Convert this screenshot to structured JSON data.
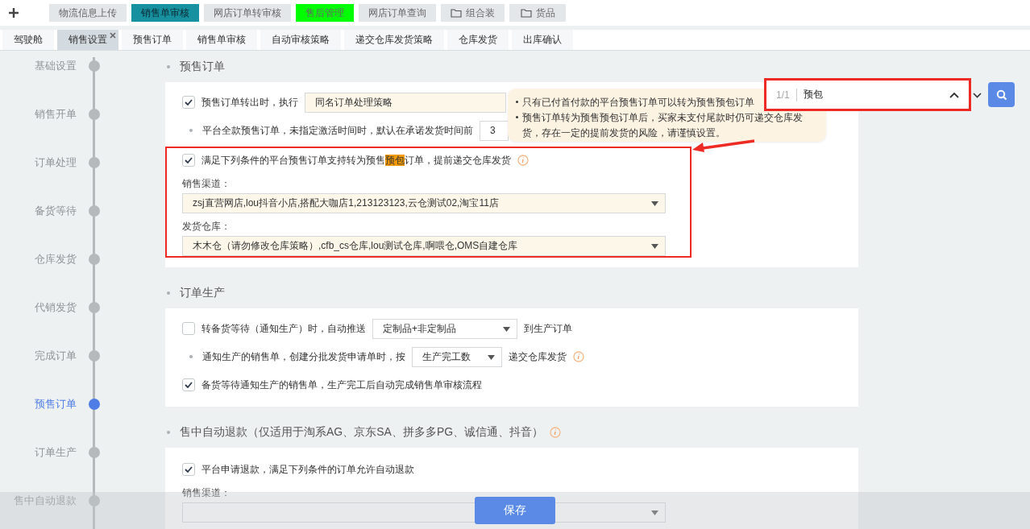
{
  "top_tabs": [
    {
      "label": "物流信息上传",
      "selected": false,
      "color": "#e4e7ea"
    },
    {
      "label": "销售单审核",
      "selected": true,
      "color": "#17909f"
    },
    {
      "label": "网店订单转审核",
      "selected": false,
      "color": "#e4e7ea"
    },
    {
      "label": "售后管理",
      "selected": false,
      "color": "#00ff00"
    },
    {
      "label": "网店订单查询",
      "selected": false,
      "color": "#e4e7ea"
    },
    {
      "label": "组合装",
      "selected": false,
      "folder": true,
      "color": "#e4e7ea"
    },
    {
      "label": "货品",
      "selected": false,
      "folder": true,
      "color": "#e4e7ea"
    }
  ],
  "sub_tabs": [
    {
      "label": "驾驶舱",
      "selected": false,
      "closable": false
    },
    {
      "label": "销售设置",
      "selected": true,
      "closable": true
    },
    {
      "label": "预售订单",
      "selected": false,
      "closable": false
    },
    {
      "label": "销售单审核",
      "selected": false,
      "closable": false
    },
    {
      "label": "自动审核策略",
      "selected": false,
      "closable": false
    },
    {
      "label": "递交仓库发货策略",
      "selected": false,
      "closable": false
    },
    {
      "label": "仓库发货",
      "selected": false,
      "closable": false
    },
    {
      "label": "出库确认",
      "selected": false,
      "closable": false
    }
  ],
  "timeline": [
    {
      "label": "基础设置",
      "selected": false
    },
    {
      "label": "销售开单",
      "selected": false
    },
    {
      "label": "订单处理",
      "selected": false
    },
    {
      "label": "备货等待",
      "selected": false
    },
    {
      "label": "仓库发货",
      "selected": false
    },
    {
      "label": "代销发货",
      "selected": false
    },
    {
      "label": "完成订单",
      "selected": false
    },
    {
      "label": "预售订单",
      "selected": true
    },
    {
      "label": "订单生产",
      "selected": false
    },
    {
      "label": "售中自动退款",
      "selected": false
    }
  ],
  "sections": [
    {
      "heading": "预售订单",
      "rows": [
        {
          "kind": "check_select",
          "checked": true,
          "label": "预售订单转出时，执行",
          "value": "同名订单处理策略"
        },
        {
          "kind": "bullet_input",
          "label": "平台全款预售订单，未指定激活时间时，默认在承诺发货时间前",
          "value": "3"
        },
        {
          "kind": "check_group",
          "checked": true,
          "outlined": true,
          "label_before": "满足下列条件的平台预售订单支持转为预售",
          "match": "预包",
          "label_after": "订单，提前递交仓库发货",
          "info": true,
          "fields": [
            {
              "label": "销售渠道：",
              "value": "zsj直营网店,lou抖音小店,搭配大咖店1,213123123,云仓测试02,淘宝11店"
            },
            {
              "label": "发货仓库：",
              "value": "木木仓（请勿修改仓库策略）,cfb_cs仓库,lou测试仓库,啊喂仓,OMS自建仓库"
            }
          ]
        }
      ]
    },
    {
      "heading": "订单生产",
      "rows": [
        {
          "kind": "check_select",
          "checked": false,
          "label": "转备货等待（通知生产）时，自动推送",
          "value": "定制品+非定制品",
          "dropdown": true,
          "suffix": "到生产订单"
        },
        {
          "kind": "bullet_select",
          "label": "通知生产的销售单，创建分批发货申请单时，按",
          "value": "生产完工数",
          "suffix": "递交仓库发货",
          "info": true
        },
        {
          "kind": "check",
          "checked": true,
          "label": "备货等待通知生产的销售单，生产完工后自动完成销售单审核流程"
        }
      ]
    },
    {
      "heading": "售中自动退款（仅适用于淘系AG、京东SA、拼多多PG、诚信通、抖音）",
      "info": true,
      "rows": [
        {
          "kind": "check_group",
          "checked": true,
          "label_before": "平台申请退款，满足下列条件的订单允许自动退款",
          "fields": [
            {
              "label": "销售渠道："
            }
          ]
        }
      ]
    }
  ],
  "search": {
    "counter": "1/1",
    "query": "预包"
  },
  "tooltip": {
    "lines": [
      "只有已付首付款的平台预售订单可以转为预售预包订单",
      "预售订单转为预售预包订单后，买家未支付尾款时仍可递交仓库发货，存在一定的提前发货的风险，请谨慎设置。"
    ]
  },
  "save_button": "保存"
}
